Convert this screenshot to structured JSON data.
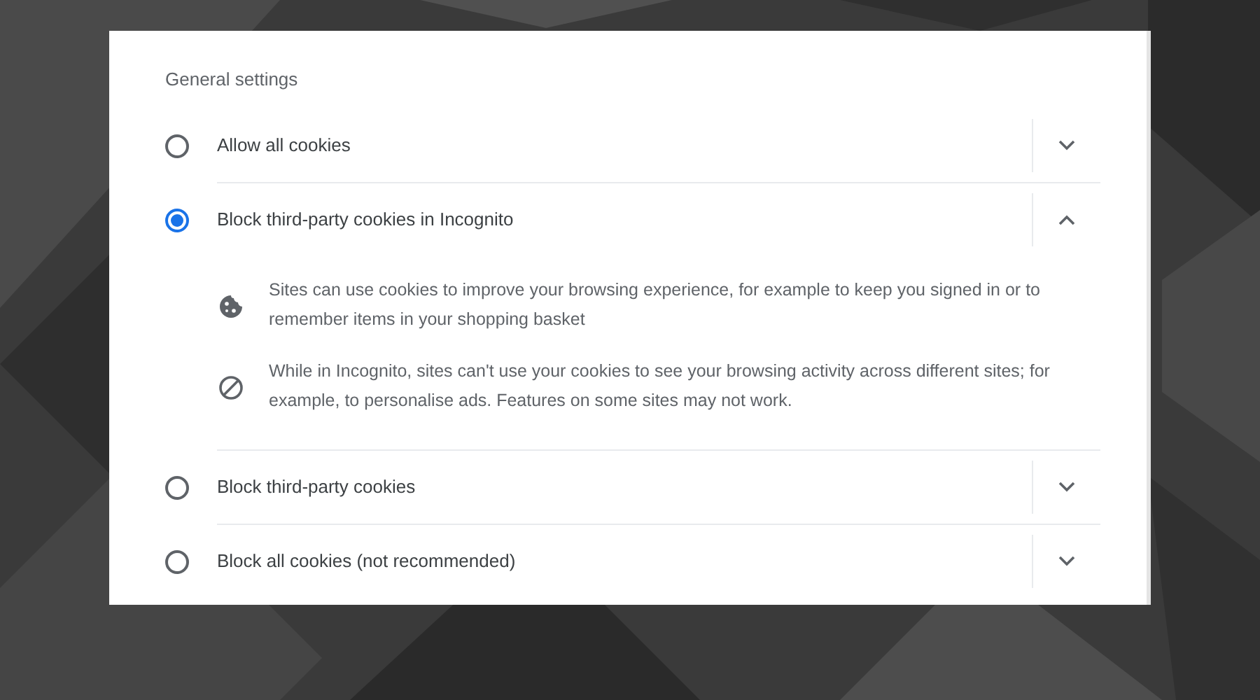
{
  "section_title": "General settings",
  "options": [
    {
      "label": "Allow all cookies",
      "selected": false,
      "expanded": false
    },
    {
      "label": "Block third-party cookies in Incognito",
      "selected": true,
      "expanded": true,
      "details": [
        {
          "kind": "cookie",
          "text": "Sites can use cookies to improve your browsing experience, for example to keep you signed in or to remember items in your shopping basket"
        },
        {
          "kind": "block",
          "text": "While in Incognito, sites can't use your cookies to see your browsing activity across different sites; for example, to personalise ads. Features on some sites may not work."
        }
      ]
    },
    {
      "label": "Block third-party cookies",
      "selected": false,
      "expanded": false
    },
    {
      "label": "Block all cookies (not recommended)",
      "selected": false,
      "expanded": false
    }
  ]
}
